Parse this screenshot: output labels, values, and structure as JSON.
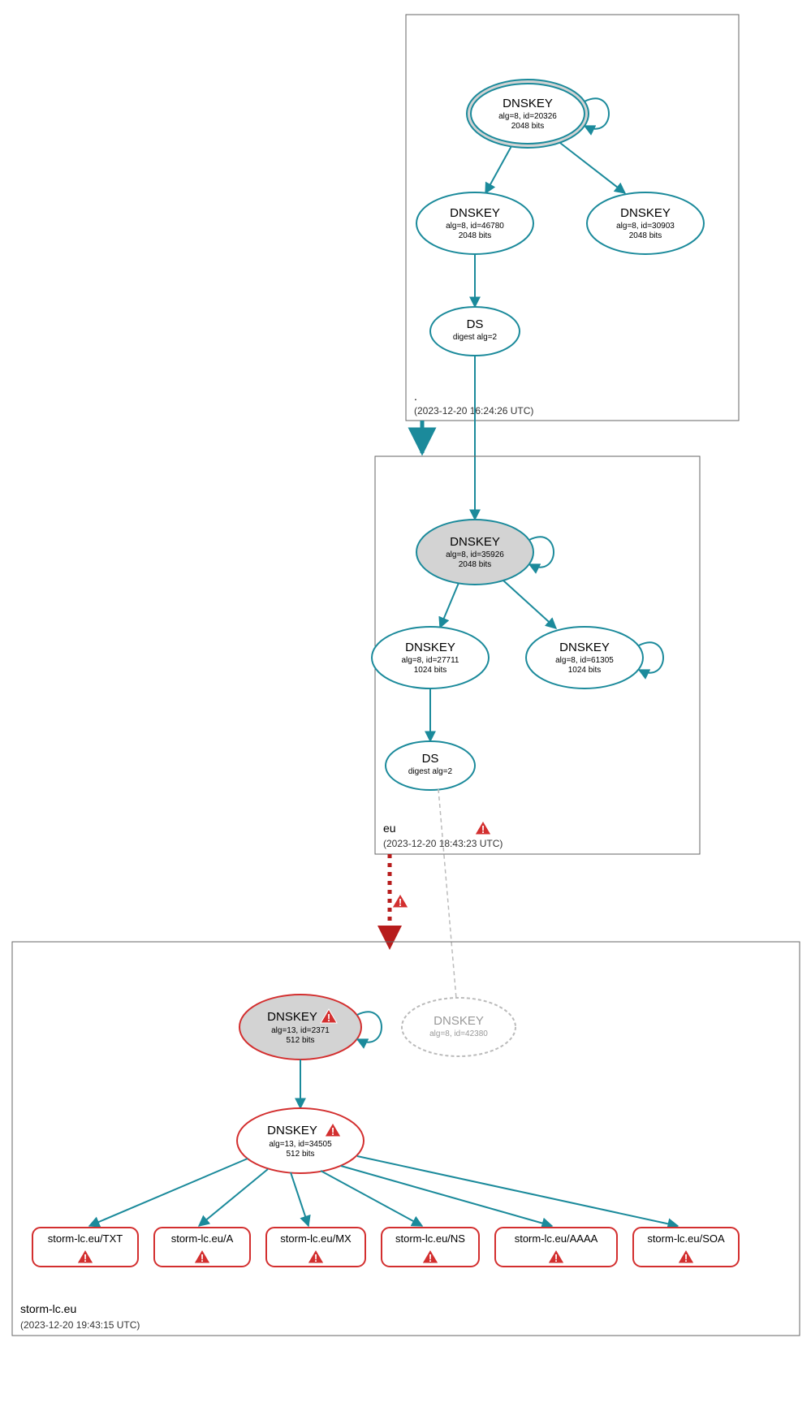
{
  "zones": {
    "root": {
      "label": ".",
      "timestamp": "(2023-12-20 16:24:26 UTC)"
    },
    "eu": {
      "label": "eu",
      "timestamp": "(2023-12-20 18:43:23 UTC)"
    },
    "storm": {
      "label": "storm-lc.eu",
      "timestamp": "(2023-12-20 19:43:15 UTC)"
    }
  },
  "nodes": {
    "root_ksk": {
      "title": "DNSKEY",
      "line1": "alg=8, id=20326",
      "line2": "2048 bits"
    },
    "root_zsk1": {
      "title": "DNSKEY",
      "line1": "alg=8, id=46780",
      "line2": "2048 bits"
    },
    "root_zsk2": {
      "title": "DNSKEY",
      "line1": "alg=8, id=30903",
      "line2": "2048 bits"
    },
    "root_ds": {
      "title": "DS",
      "line1": "digest alg=2"
    },
    "eu_ksk": {
      "title": "DNSKEY",
      "line1": "alg=8, id=35926",
      "line2": "2048 bits"
    },
    "eu_zsk1": {
      "title": "DNSKEY",
      "line1": "alg=8, id=27711",
      "line2": "1024 bits"
    },
    "eu_zsk2": {
      "title": "DNSKEY",
      "line1": "alg=8, id=61305",
      "line2": "1024 bits"
    },
    "eu_ds": {
      "title": "DS",
      "line1": "digest alg=2"
    },
    "storm_ksk": {
      "title": "DNSKEY",
      "line1": "alg=13, id=2371",
      "line2": "512 bits"
    },
    "storm_zsk": {
      "title": "DNSKEY",
      "line1": "alg=13, id=34505",
      "line2": "512 bits"
    },
    "storm_missing": {
      "title": "DNSKEY",
      "line1": "alg=8, id=42380"
    }
  },
  "rrsets": [
    {
      "label": "storm-lc.eu/TXT"
    },
    {
      "label": "storm-lc.eu/A"
    },
    {
      "label": "storm-lc.eu/MX"
    },
    {
      "label": "storm-lc.eu/NS"
    },
    {
      "label": "storm-lc.eu/AAAA"
    },
    {
      "label": "storm-lc.eu/SOA"
    }
  ],
  "icons": {
    "warning_glyph": "!"
  },
  "colors": {
    "teal": "#1B8A9B",
    "red": "#d32f2f",
    "dark_red": "#b71c1c",
    "grey_fill": "#d3d3d3",
    "light_grey": "#bbb"
  }
}
